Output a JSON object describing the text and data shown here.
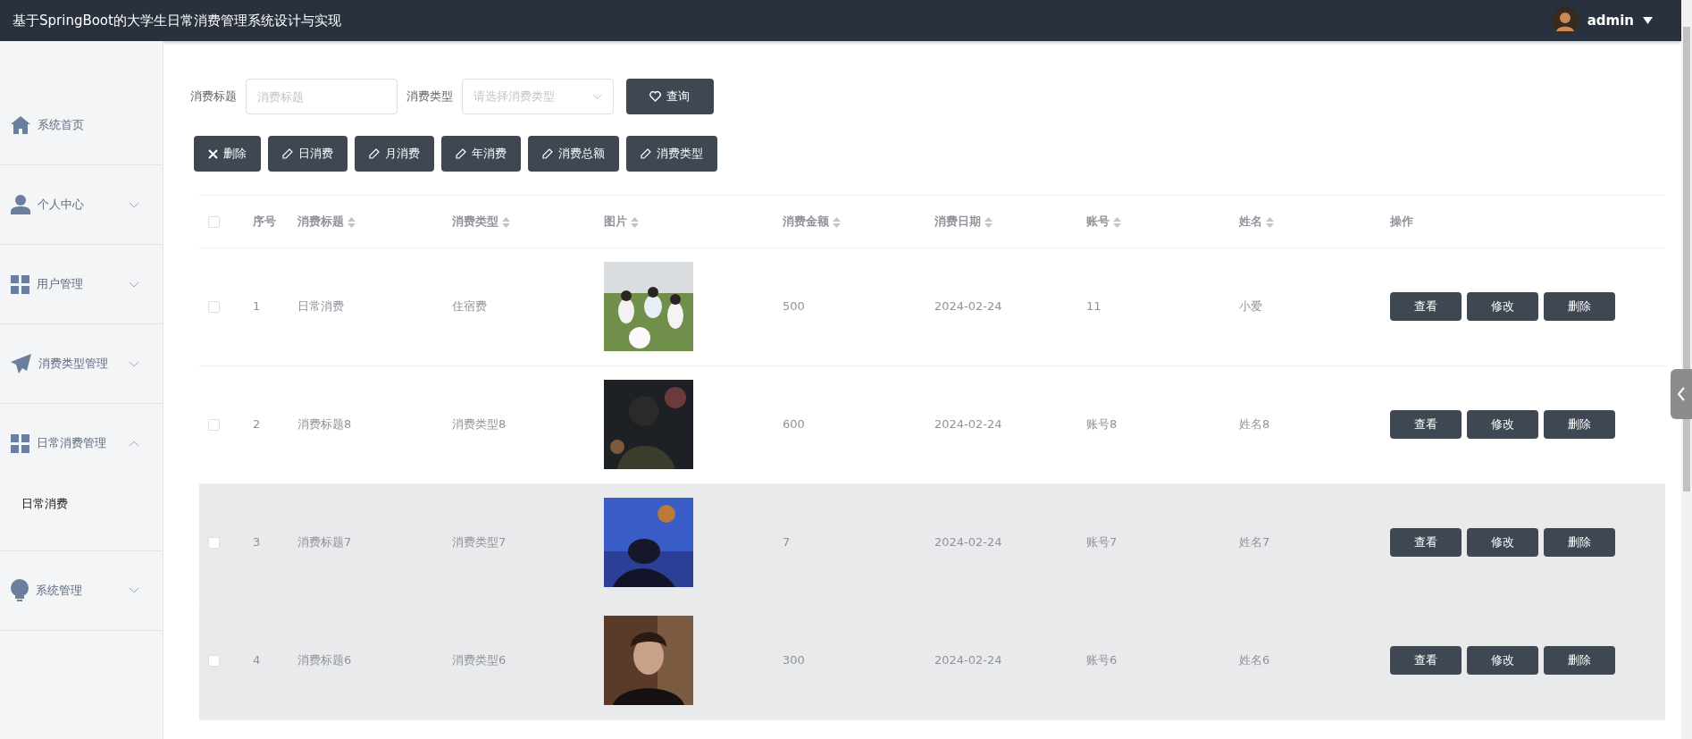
{
  "header": {
    "title": "基于SpringBoot的大学生日常消费管理系统设计与实现",
    "user": "admin"
  },
  "sidebar": {
    "items": [
      {
        "label": "系统首页",
        "kind": "link"
      },
      {
        "label": "个人中心",
        "kind": "menu",
        "expanded": false
      },
      {
        "label": "用户管理",
        "kind": "menu",
        "expanded": false
      },
      {
        "label": "消费类型管理",
        "kind": "menu",
        "expanded": false
      },
      {
        "label": "日常消费管理",
        "kind": "menu",
        "expanded": true,
        "children": [
          {
            "label": "日常消费",
            "selected": true
          }
        ]
      },
      {
        "label": "系统管理",
        "kind": "menu",
        "expanded": false
      }
    ]
  },
  "search": {
    "fields": [
      {
        "label": "消费标题",
        "placeholder": "消费标题",
        "kind": "text"
      },
      {
        "label": "消费类型",
        "placeholder": "请选择消费类型",
        "kind": "select"
      }
    ],
    "button": "查询"
  },
  "toolbar": [
    {
      "label": "删除",
      "kind": "delete"
    },
    {
      "label": "日消费",
      "kind": "edit"
    },
    {
      "label": "月消费",
      "kind": "edit"
    },
    {
      "label": "年消费",
      "kind": "edit"
    },
    {
      "label": "消费总额",
      "kind": "edit"
    },
    {
      "label": "消费类型",
      "kind": "edit"
    }
  ],
  "table": {
    "select_all_checked": false,
    "columns": [
      {
        "label": "序号",
        "sortable": false
      },
      {
        "label": "消费标题",
        "sortable": true
      },
      {
        "label": "消费类型",
        "sortable": true
      },
      {
        "label": "图片",
        "sortable": true
      },
      {
        "label": "消费金额",
        "sortable": true
      },
      {
        "label": "消费日期",
        "sortable": true
      },
      {
        "label": "账号",
        "sortable": true
      },
      {
        "label": "姓名",
        "sortable": true
      },
      {
        "label": "操作",
        "sortable": false
      }
    ],
    "rows": [
      {
        "checked": false,
        "highlighted": false,
        "cells": [
          {
            "kind": "text",
            "text": "1"
          },
          {
            "kind": "text",
            "text": "日常消费"
          },
          {
            "kind": "text",
            "text": "住宿费"
          },
          {
            "kind": "picture"
          },
          {
            "kind": "text",
            "text": "500"
          },
          {
            "kind": "text",
            "text": "2024-02-24"
          },
          {
            "kind": "text",
            "text": "11"
          },
          {
            "kind": "text",
            "text": "小爱"
          },
          {
            "kind": "actions",
            "actions": [
              "查看",
              "修改",
              "删除"
            ]
          }
        ]
      },
      {
        "checked": false,
        "highlighted": false,
        "cells": [
          {
            "kind": "text",
            "text": "2"
          },
          {
            "kind": "text",
            "text": "消费标题8"
          },
          {
            "kind": "text",
            "text": "消费类型8"
          },
          {
            "kind": "picture"
          },
          {
            "kind": "text",
            "text": "600"
          },
          {
            "kind": "text",
            "text": "2024-02-24"
          },
          {
            "kind": "text",
            "text": "账号8"
          },
          {
            "kind": "text",
            "text": "姓名8"
          },
          {
            "kind": "actions",
            "actions": [
              "查看",
              "修改",
              "删除"
            ]
          }
        ]
      },
      {
        "checked": false,
        "highlighted": true,
        "cells": [
          {
            "kind": "text",
            "text": "3"
          },
          {
            "kind": "text",
            "text": "消费标题7"
          },
          {
            "kind": "text",
            "text": "消费类型7"
          },
          {
            "kind": "picture"
          },
          {
            "kind": "text",
            "text": "7"
          },
          {
            "kind": "text",
            "text": "2024-02-24"
          },
          {
            "kind": "text",
            "text": "账号7"
          },
          {
            "kind": "text",
            "text": "姓名7"
          },
          {
            "kind": "actions",
            "actions": [
              "查看",
              "修改",
              "删除"
            ]
          }
        ]
      },
      {
        "checked": false,
        "highlighted": true,
        "cells": [
          {
            "kind": "text",
            "text": "4"
          },
          {
            "kind": "text",
            "text": "消费标题6"
          },
          {
            "kind": "text",
            "text": "消费类型6"
          },
          {
            "kind": "picture"
          },
          {
            "kind": "text",
            "text": "300"
          },
          {
            "kind": "text",
            "text": "2024-02-24"
          },
          {
            "kind": "text",
            "text": "账号6"
          },
          {
            "kind": "text",
            "text": "姓名6"
          },
          {
            "kind": "actions",
            "actions": [
              "查看",
              "修改",
              "删除"
            ]
          }
        ]
      }
    ]
  }
}
